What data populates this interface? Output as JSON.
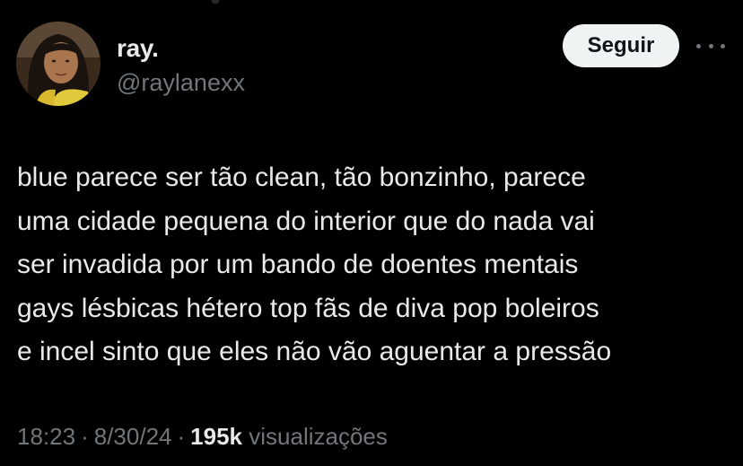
{
  "author": {
    "display_name": "ray.",
    "handle": "@raylanexx",
    "avatar_icon": "profile-photo-avatar"
  },
  "actions": {
    "follow_label": "Seguir",
    "more_icon": "more-horizontal-icon"
  },
  "tweet": {
    "lines": [
      "blue parece ser tão clean, tão bonzinho, parece",
      "uma cidade pequena do interior que do nada vai",
      "ser invadida por um bando de doentes mentais",
      "gays lésbicas hétero top fãs de diva pop boleiros",
      "e incel sinto que eles não vão aguentar a pressão"
    ]
  },
  "meta": {
    "time": "18:23",
    "separator": "·",
    "date": "8/30/24",
    "views_count": "195k",
    "views_label": "visualizações"
  },
  "colors": {
    "background": "#000000",
    "text_primary": "#e7e9ea",
    "text_secondary": "#71767b",
    "button_bg": "#eff3f4",
    "button_text": "#0f1419"
  }
}
